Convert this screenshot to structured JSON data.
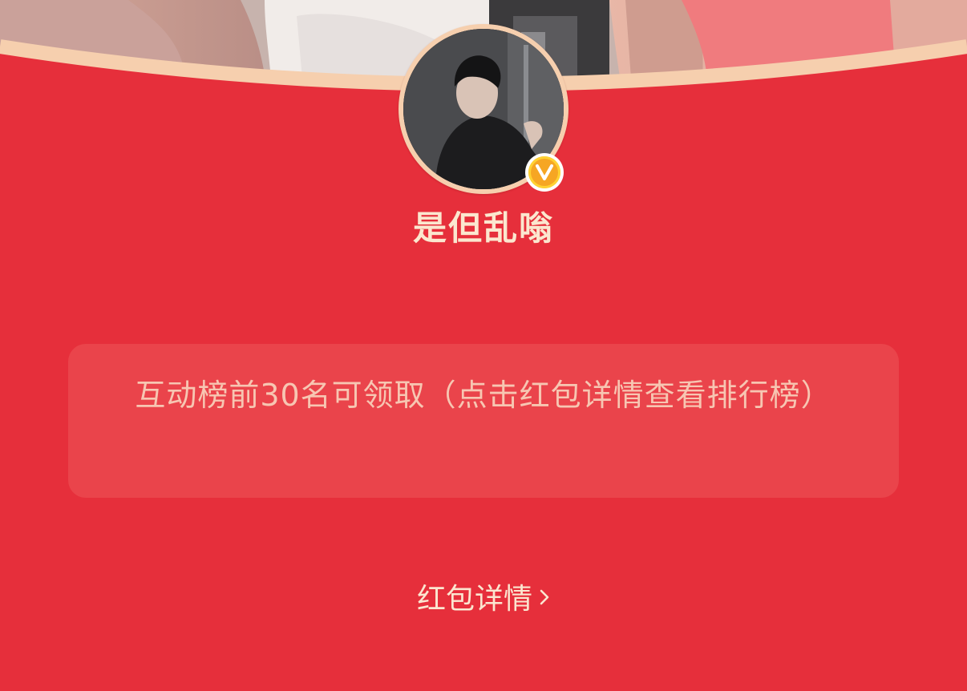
{
  "header": {
    "cover_alt": "cover-photo",
    "avatar_alt": "user-avatar"
  },
  "profile": {
    "name": "是但乱嗡",
    "verified_icon": "verified-v-badge-icon"
  },
  "rule": {
    "text": "互动榜前30名可领取（点击红包详情查看排行榜）"
  },
  "footer": {
    "detail_label": "红包详情",
    "detail_icon": "chevron-right-icon"
  },
  "colors": {
    "background": "#e62f3b",
    "arc": "#f6cfae",
    "text_light": "#fbe7cf",
    "badge": "#f6a623"
  }
}
